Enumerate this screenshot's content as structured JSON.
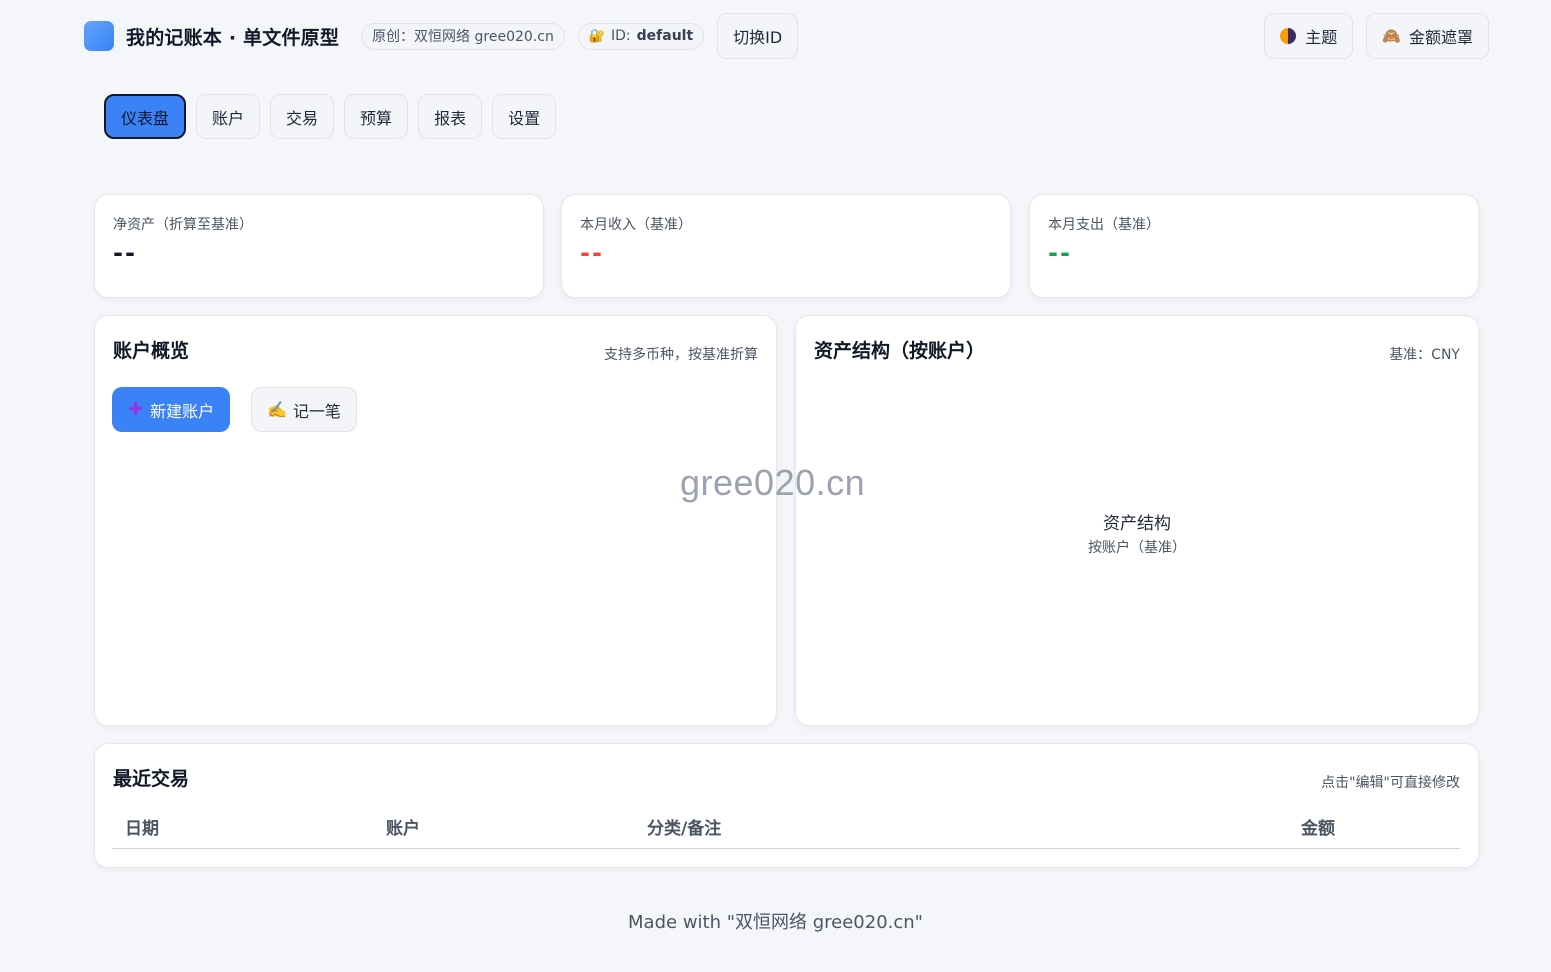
{
  "header": {
    "title": "我的记账本 · 单文件原型",
    "origin_badge": "原创：双恒网络 gree020.cn",
    "id_label": "ID:",
    "id_value": "default",
    "switch_id": "切换ID",
    "theme": "主题",
    "mask": "金额遮罩",
    "icons": {
      "logo": "logo-square",
      "id": "lock-icon",
      "theme": "half-moon-icon",
      "mask": "monkey-icon"
    }
  },
  "tabs": [
    {
      "label": "仪表盘",
      "active": true
    },
    {
      "label": "账户",
      "active": false
    },
    {
      "label": "交易",
      "active": false
    },
    {
      "label": "预算",
      "active": false
    },
    {
      "label": "报表",
      "active": false
    },
    {
      "label": "设置",
      "active": false
    }
  ],
  "stats": {
    "net": {
      "label": "净资产（折算至基准）",
      "value": "--"
    },
    "income": {
      "label": "本月收入（基准）",
      "value": "--"
    },
    "expense": {
      "label": "本月支出（基准）",
      "value": "--"
    }
  },
  "accounts": {
    "title": "账户概览",
    "hint": "支持多币种，按基准折算",
    "new_account": "新建账户",
    "record": "记一笔"
  },
  "structure": {
    "title": "资产结构（按账户）",
    "base_hint": "基准：CNY",
    "chart_title": "资产结构",
    "chart_subtitle": "按账户（基准）"
  },
  "recent": {
    "title": "最近交易",
    "hint": "点击\"编辑\"可直接修改",
    "columns": [
      "日期",
      "账户",
      "分类/备注",
      "金额"
    ]
  },
  "watermark": "gree020.cn",
  "footer": "Made with \"双恒网络 gree020.cn\"",
  "colors": {
    "primary": "#3b82f6",
    "income": "#ef4444",
    "expense": "#16a34a",
    "background": "#f5f6fa"
  }
}
